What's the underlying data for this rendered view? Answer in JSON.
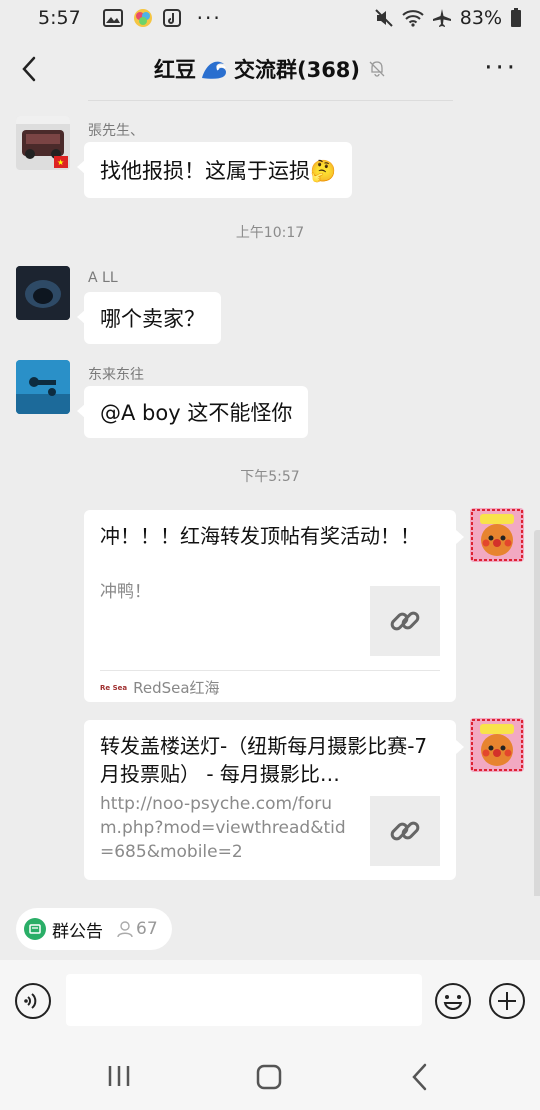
{
  "status": {
    "time": "5:57",
    "battery": "83%",
    "icons_left": [
      "gallery-icon",
      "app-icon",
      "tiktok-icon",
      "more-dots-icon"
    ],
    "icons_right": [
      "mute-icon",
      "wifi-icon",
      "airplane-icon",
      "battery-icon"
    ],
    "dots": "···"
  },
  "header": {
    "title_pre": "红豆",
    "title_post": "交流群(368)",
    "more": "···"
  },
  "messages": [
    {
      "sender": "張先生、",
      "text": "找他报损！这属于运损🤔"
    },
    {
      "time": "上午10:17"
    },
    {
      "sender": "A LL",
      "text": "哪个卖家？"
    },
    {
      "sender": "东来东往",
      "text": "@A boy  这不能怪你"
    },
    {
      "time": "下午5:57"
    }
  ],
  "cards": [
    {
      "title": "冲！！！红海转发顶帖有奖活动！！",
      "desc": "冲鸭！",
      "source": "RedSea红海",
      "logo": "Re Sea"
    },
    {
      "title": "转发盖楼送灯-（纽斯每月摄影比赛-7月投票贴） - 每月摄影比…",
      "desc": "http://noo-psyche.com/forum.php?mod=viewthread&tid=685&mobile=2"
    }
  ],
  "notice": {
    "label": "群公告",
    "count": "67"
  },
  "colors": {
    "background": "#ededed",
    "bubble": "#ffffff",
    "accent_green": "#2aae67"
  }
}
